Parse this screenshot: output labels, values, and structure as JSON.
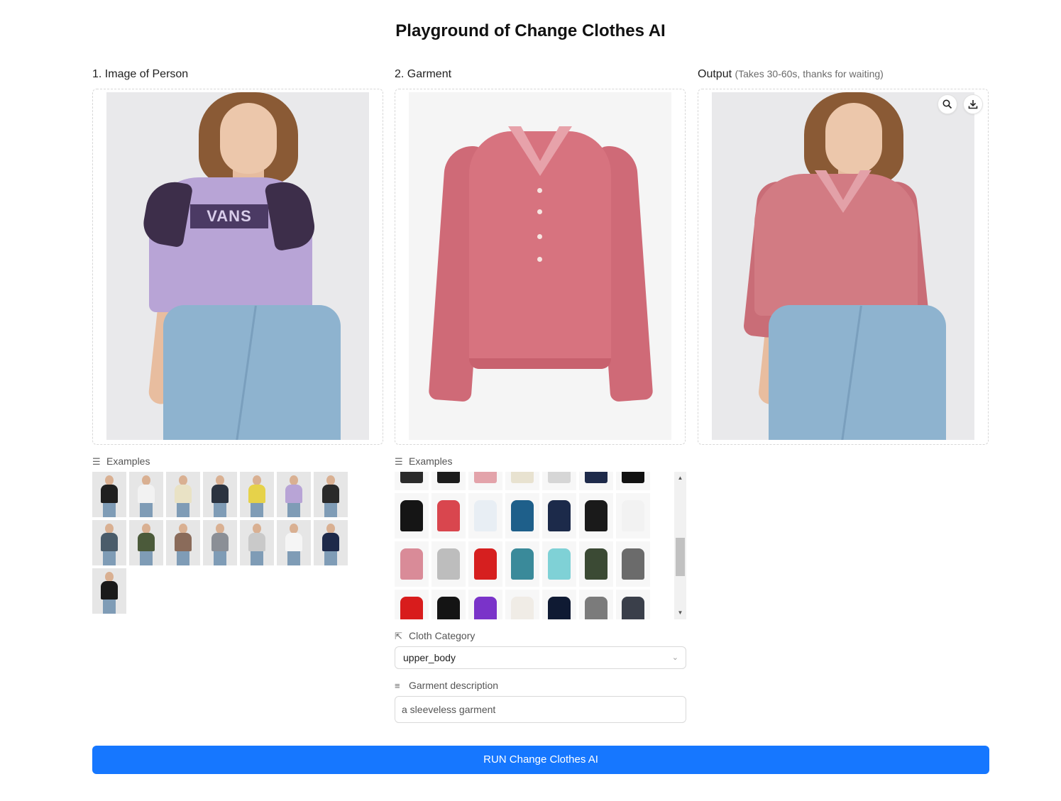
{
  "page": {
    "title": "Playground of Change Clothes AI"
  },
  "person": {
    "label": "1. Image of Person",
    "examples_label": "Examples",
    "thumb_count": 15
  },
  "garment": {
    "label": "2. Garment",
    "examples_label": "Examples",
    "cloth_category_label": "Cloth Category",
    "cloth_category_value": "upper_body",
    "description_label": "Garment description",
    "description_placeholder": "a sleeveless garment"
  },
  "output": {
    "label": "Output",
    "note": "(Takes 30-60s, thanks for waiting)"
  },
  "person_photo": {
    "logo_text": "VANS"
  },
  "actions": {
    "run_label": "RUN Change Clothes AI"
  },
  "icons": {
    "examples": "list-icon",
    "cloth_category": "select-cursor-icon",
    "description": "align-left-icon",
    "zoom": "search-icon",
    "download": "download-icon",
    "dropdown": "chevron-down-icon"
  },
  "colors": {
    "accent": "#1677ff",
    "border": "#d9d9d9"
  }
}
